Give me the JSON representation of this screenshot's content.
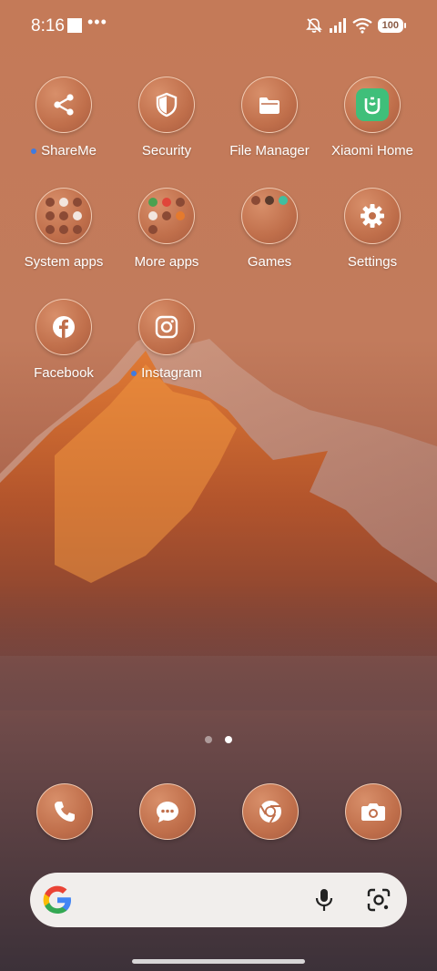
{
  "status_bar": {
    "time": "8:16",
    "more_icon": "•••",
    "battery": "100",
    "icons": [
      "mute-icon",
      "signal-icon",
      "wifi-icon",
      "battery-icon"
    ]
  },
  "apps": [
    {
      "label": "ShareMe",
      "icon": "share-icon",
      "has_dot": true
    },
    {
      "label": "Security",
      "icon": "shield-icon",
      "has_dot": false
    },
    {
      "label": "File Manager",
      "icon": "folder-icon",
      "has_dot": false
    },
    {
      "label": "Xiaomi Home",
      "icon": "xiaomi-home-icon",
      "has_dot": false
    },
    {
      "label": "System apps",
      "icon": "folder-grid-icon",
      "has_dot": false
    },
    {
      "label": "More apps",
      "icon": "folder-grid-icon",
      "has_dot": false
    },
    {
      "label": "Games",
      "icon": "folder-grid-icon",
      "has_dot": false
    },
    {
      "label": "Settings",
      "icon": "gear-icon",
      "has_dot": false
    },
    {
      "label": "Facebook",
      "icon": "facebook-icon",
      "has_dot": false
    },
    {
      "label": "Instagram",
      "icon": "instagram-icon",
      "has_dot": true
    }
  ],
  "page_indicator": {
    "count": 2,
    "active": 2
  },
  "dock": [
    "phone-icon",
    "messages-icon",
    "chrome-icon",
    "camera-icon"
  ],
  "search": {
    "placeholder": "",
    "logo": "google-logo-icon",
    "mic": "mic-icon",
    "lens": "lens-icon"
  },
  "colors": {
    "icon_fill": "#c06f4b",
    "accent_dot": "#3f7be0",
    "xiaomi_green": "#3fbf7a"
  }
}
